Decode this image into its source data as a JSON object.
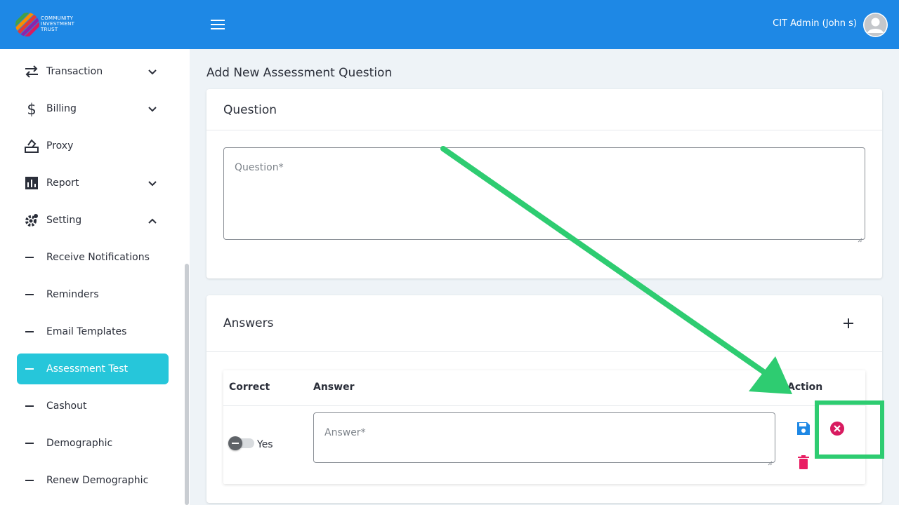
{
  "header": {
    "logo_lines": [
      "COMMUNITY",
      "INVESTMENT",
      "TRUST"
    ],
    "menu_icon": "hamburger-menu-icon",
    "user_name": "CIT Admin (John s)",
    "avatar_icon": "user-avatar-icon",
    "color": "#1e88e5"
  },
  "sidebar": {
    "items": [
      {
        "label": "Transaction",
        "icon": "swap-arrows-icon",
        "chevron": "down"
      },
      {
        "label": "Billing",
        "icon": "dollar-icon",
        "chevron": "down"
      },
      {
        "label": "Proxy",
        "icon": "ballot-box-icon"
      },
      {
        "label": "Report",
        "icon": "bar-chart-icon",
        "chevron": "down"
      },
      {
        "label": "Setting",
        "icon": "gear-icon",
        "chevron": "up"
      }
    ],
    "subitems": [
      {
        "label": "Receive Notifications"
      },
      {
        "label": "Reminders"
      },
      {
        "label": "Email Templates"
      },
      {
        "label": "Assessment Test",
        "active": true
      },
      {
        "label": "Cashout"
      },
      {
        "label": "Demographic"
      },
      {
        "label": "Renew Demographic"
      }
    ],
    "active_color": "#26c6da"
  },
  "main": {
    "page_title": "Add New Assessment Question",
    "question_card": {
      "title": "Question",
      "placeholder": "Question*"
    },
    "answers_card": {
      "title": "Answers",
      "add_icon": "plus-icon",
      "columns": [
        "Correct",
        "Answer",
        "Action"
      ],
      "rows": [
        {
          "toggle_label": "Yes",
          "answer_placeholder": "Answer*",
          "actions": [
            "save-icon",
            "cancel-icon",
            "delete-icon"
          ]
        }
      ]
    }
  },
  "annotation": {
    "color": "#2ecc71",
    "shape": "arrow-and-box"
  }
}
